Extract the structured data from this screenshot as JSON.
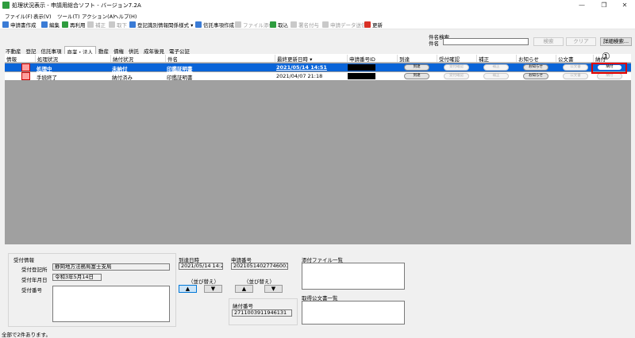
{
  "window": {
    "title": "処理状況表示 - 申請用総合ソフト - バージョン7.2A",
    "minimize": "—",
    "maximize": "❐",
    "close": "✕"
  },
  "menu": [
    "ファイル(F)",
    "表示(V)",
    "ツール(T)",
    "アクション(A)",
    "ヘルプ(H)"
  ],
  "toolbar": [
    {
      "label": "申請書作成",
      "color": "#3a7bd5",
      "enabled": true
    },
    {
      "label": "編集",
      "color": "#3a7bd5",
      "enabled": true
    },
    {
      "label": "再利用",
      "color": "#2e9c3e",
      "enabled": true
    },
    {
      "label": "補正",
      "color": "#888888",
      "enabled": false
    },
    {
      "label": "取下",
      "color": "#888888",
      "enabled": false
    },
    {
      "label": "登記識別情報関係様式 ▾",
      "color": "#3a7bd5",
      "enabled": true
    },
    {
      "label": "信託事項作成",
      "color": "#3a7bd5",
      "enabled": true
    },
    {
      "label": "ファイル添付",
      "color": "#888888",
      "enabled": false
    },
    {
      "label": "取込",
      "color": "#2e9c3e",
      "enabled": true
    },
    {
      "label": "署名付与",
      "color": "#888888",
      "enabled": false
    },
    {
      "label": "申請データ送信",
      "color": "#888888",
      "enabled": false
    },
    {
      "label": "更新",
      "color": "#d93025",
      "enabled": true
    }
  ],
  "search": {
    "heading": "件名検索",
    "label": "件名",
    "value": "",
    "search_button": "検索",
    "clear_button": "クリア",
    "advanced_button": "詳細検索..."
  },
  "tabs": [
    {
      "label": "不動産",
      "active": false
    },
    {
      "label": "登記",
      "active": false
    },
    {
      "label": "信託事項",
      "active": false
    },
    {
      "label": "商業・法人",
      "active": true
    },
    {
      "label": "動産",
      "active": false
    },
    {
      "label": "債権",
      "active": false
    },
    {
      "label": "供託",
      "active": false
    },
    {
      "label": "成年後見",
      "active": false
    },
    {
      "label": "電子公証",
      "active": false
    }
  ],
  "grid": {
    "columns": [
      "情報",
      "処理状況",
      "納付状況",
      "件名",
      "最終更新日時 ▾",
      "申請番号ID",
      "到達",
      "受付確認",
      "補正",
      "お知らせ",
      "公文書",
      "納付"
    ],
    "rows": [
      {
        "status": "処理中",
        "payment": "未納付",
        "subject": "印鑑証明書",
        "updated": "2021/05/14 14:51",
        "arrival": "到達",
        "receipt": "受付確認",
        "correction": "補正",
        "notice": "お知らせ",
        "document": "公文書",
        "pay": "納付"
      },
      {
        "status": "手続終了",
        "payment": "納付済み",
        "subject": "印鑑証明書",
        "updated": "2021/04/07 21:18",
        "arrival": "到達",
        "receipt": "受付確認",
        "correction": "補正",
        "notice": "お知らせ",
        "document": "公文書",
        "pay": "納付"
      }
    ]
  },
  "annotation": {
    "marker": "①"
  },
  "detail": {
    "reception": {
      "title": "受付情報",
      "office_label": "受付登記所",
      "office_value": "静岡地方法務局富士支局",
      "date_label": "受付年月日",
      "date_value": "令和3年5月14日",
      "number_label": "受付番号"
    },
    "arrival": {
      "label": "到達日時",
      "value": "2021/05/14 14:20",
      "sort_label": "（並び替え）"
    },
    "application": {
      "label": "申請番号",
      "value": "20210514027746001",
      "sort_label": "（並び替え）"
    },
    "payment": {
      "label": "納付番号",
      "value": "2711003911946131"
    },
    "attachments_label": "添付ファイル一覧",
    "documents_label": "取得公文書一覧",
    "up_arrow": "▲",
    "down_arrow": "▼"
  },
  "statusbar": "全部で2件あります。"
}
